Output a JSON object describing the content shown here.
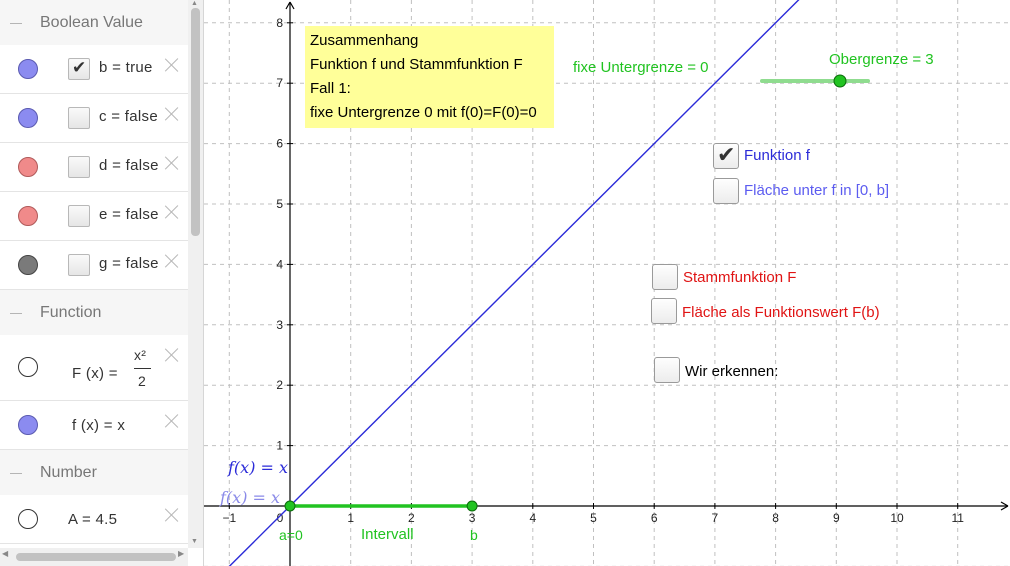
{
  "algebra": {
    "categories": {
      "boolean": "Boolean Value",
      "function": "Function",
      "number": "Number"
    },
    "booleans": [
      {
        "name": "b",
        "text": "b = true",
        "checked": true,
        "color": "#8b8bf0"
      },
      {
        "name": "c",
        "text": "c = false",
        "checked": false,
        "color": "#8b8bf0"
      },
      {
        "name": "d",
        "text": "d = false",
        "checked": false,
        "color": "#f08a8a"
      },
      {
        "name": "e",
        "text": "e = false",
        "checked": false,
        "color": "#f08a8a"
      },
      {
        "name": "g",
        "text": "g = false",
        "checked": false,
        "color": "#7a7a7a"
      }
    ],
    "functions": [
      {
        "name": "F",
        "lhs": "F (x)  =",
        "num": "x²",
        "den": "2",
        "dot": "hollow"
      },
      {
        "name": "f",
        "text": "f (x)  =  x",
        "dot": "#8b8bf0"
      }
    ],
    "numbers": [
      {
        "name": "A",
        "text": "A  =  4.5",
        "dot": "hollow"
      }
    ]
  },
  "graphics": {
    "textbox": [
      "Zusammenhang",
      "Funktion f und Stammfunktion F",
      "Fall 1:",
      "fixe Untergrenze 0 mit f(0)=F(0)=0"
    ],
    "fixe_untergrenze": "fixe Untergrenze = 0",
    "obergrenze": "Obergrenze = 3",
    "checkboxes": {
      "funktion_f": {
        "label": "Funktion f",
        "checked": true
      },
      "flaeche_unter_f": {
        "label": "Fläche unter f in [0, b]",
        "checked": false
      },
      "stammfunktion": {
        "label": "Stammfunktion F",
        "checked": false
      },
      "flaeche_als_funktionswert": {
        "label": "Fläche als Funktionswert F(b)",
        "checked": false
      },
      "wir_erkennen": {
        "label": "Wir erkennen:",
        "checked": false
      }
    },
    "f_label": "f(x)  =  x",
    "f_label_ghost": "f(x)  =  x",
    "point_a": "a=0",
    "point_b": "b",
    "interval_label": "Intervall",
    "x_ticks": [
      "−1",
      "0",
      "1",
      "2",
      "3",
      "4",
      "5",
      "6",
      "7",
      "8",
      "9",
      "10",
      "11"
    ],
    "y_ticks": [
      "1",
      "2",
      "3",
      "4",
      "5",
      "6",
      "7",
      "8"
    ],
    "colors": {
      "blue": "#2b2bd8",
      "green": "#21c321",
      "red": "#e01414",
      "axis": "#000000",
      "grid": "#c0c0c0"
    }
  }
}
